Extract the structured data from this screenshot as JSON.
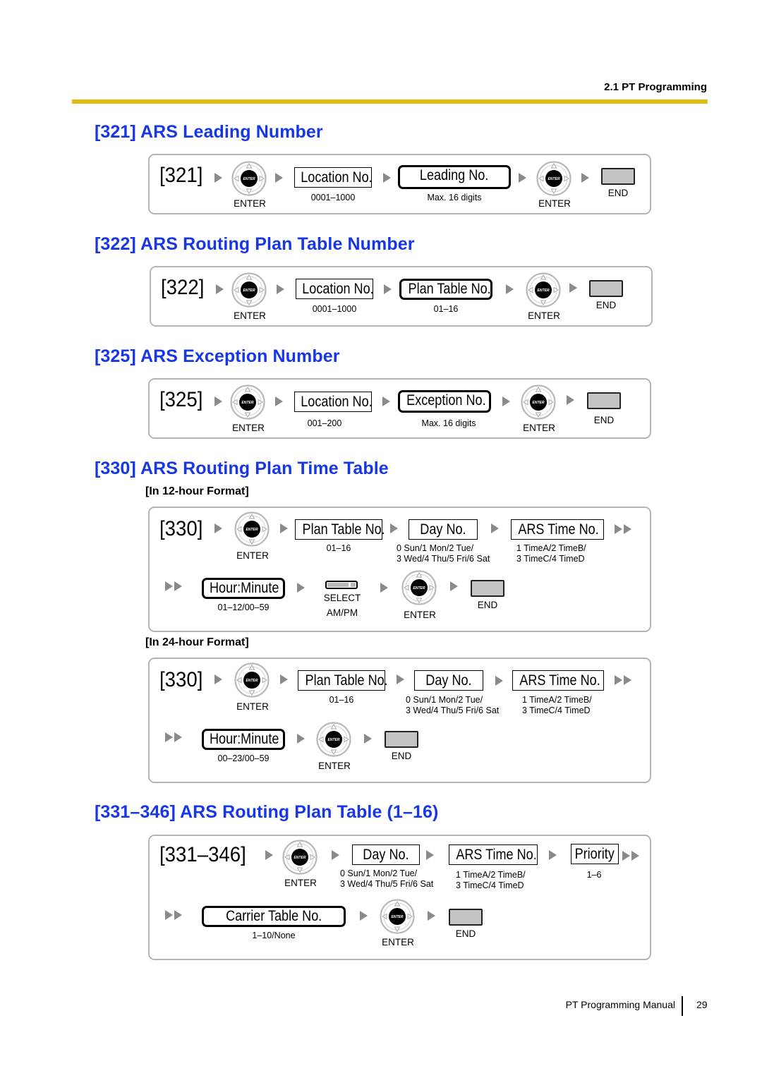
{
  "header": {
    "section": "2.1 PT Programming",
    "rule_color": "#e2bc0e"
  },
  "colors": {
    "title_blue": "#1736e6",
    "arrow_gray": "#8a8a8a",
    "end_key_gray": "#c4c4c4"
  },
  "common": {
    "enter_label": "ENTER",
    "enter_key_text": "ENTER",
    "end_label": "END",
    "select_label": "SELECT",
    "ampm_label": "AM/PM"
  },
  "sections": [
    {
      "title": "[321] ARS Leading Number",
      "code": "[321]",
      "fields": [
        {
          "label": "Location No.",
          "range": "0001–1000"
        },
        {
          "label": "Leading No.",
          "range": "Max. 16 digits"
        }
      ]
    },
    {
      "title": "[322] ARS Routing Plan Table Number",
      "code": "[322]",
      "fields": [
        {
          "label": "Location No.",
          "range": "0001–1000"
        },
        {
          "label": "Plan Table No.",
          "range": "01–16"
        }
      ]
    },
    {
      "title": "[325] ARS Exception Number",
      "code": "[325]",
      "fields": [
        {
          "label": "Location No.",
          "range": "001–200"
        },
        {
          "label": "Exception No.",
          "range": "Max. 16 digits"
        }
      ]
    },
    {
      "title": "[330] ARS Routing Plan Time Table",
      "formats": [
        {
          "label": "[In 12-hour Format]",
          "code": "[330]",
          "fields": [
            {
              "label": "Plan Table No.",
              "range": "01–16"
            },
            {
              "label": "Day No.",
              "range_line1": "0 Sun/1 Mon/2 Tue/",
              "range_line2": "3 Wed/4 Thu/5 Fri/6 Sat"
            },
            {
              "label": "ARS Time No.",
              "range_line1": "1 TimeA/2 TimeB/",
              "range_line2": "3 TimeC/4 TimeD"
            },
            {
              "label": "Hour:Minute",
              "range": "01–12/00–59"
            }
          ]
        },
        {
          "label": "[In 24-hour Format]",
          "code": "[330]",
          "fields": [
            {
              "label": "Plan Table No.",
              "range": "01–16"
            },
            {
              "label": "Day No.",
              "range_line1": "0 Sun/1 Mon/2 Tue/",
              "range_line2": "3 Wed/4 Thu/5 Fri/6 Sat"
            },
            {
              "label": "ARS Time No.",
              "range_line1": "1 TimeA/2 TimeB/",
              "range_line2": "3 TimeC/4 TimeD"
            },
            {
              "label": "Hour:Minute",
              "range": "00–23/00–59"
            }
          ]
        }
      ]
    },
    {
      "title": "[331–346] ARS Routing Plan Table (1–16)",
      "code": "[331–346]",
      "fields": [
        {
          "label": "Day No.",
          "range_line1": "0 Sun/1 Mon/2 Tue/",
          "range_line2": "3 Wed/4 Thu/5 Fri/6 Sat"
        },
        {
          "label": "ARS Time No.",
          "range_line1": "1 TimeA/2 TimeB/",
          "range_line2": "3 TimeC/4 TimeD"
        },
        {
          "label": "Priority",
          "range": "1–6"
        },
        {
          "label": "Carrier Table No.",
          "range": "1–10/None"
        }
      ]
    }
  ],
  "footer": {
    "manual": "PT Programming Manual",
    "page": "29"
  }
}
